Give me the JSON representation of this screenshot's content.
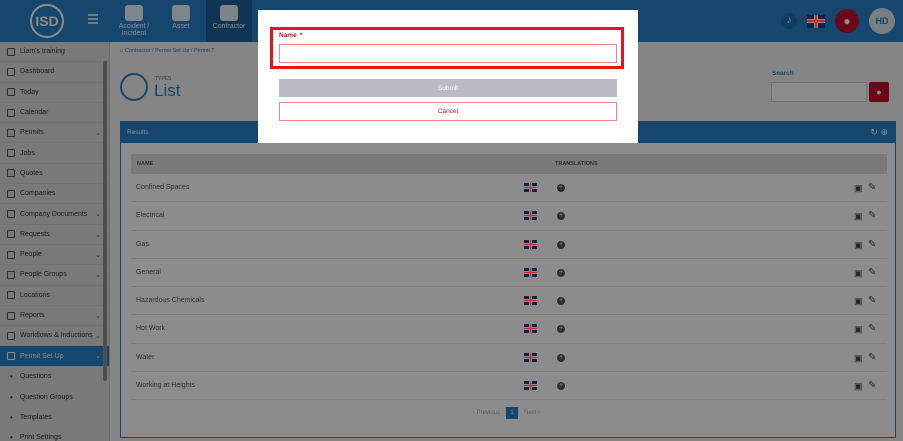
{
  "app": {
    "logo_text": "ISD",
    "nav_tabs": [
      {
        "label": "Accident / Incident"
      },
      {
        "label": "Asset"
      },
      {
        "label": "Contractor"
      }
    ],
    "user_initials": "HD"
  },
  "sidebar": {
    "items": [
      {
        "label": "Liam's training",
        "has_chevron": false
      },
      {
        "label": "Dashboard",
        "has_chevron": false
      },
      {
        "label": "Today",
        "has_chevron": false
      },
      {
        "label": "Calendar",
        "has_chevron": false
      },
      {
        "label": "Permits",
        "has_chevron": true
      },
      {
        "label": "Jobs",
        "has_chevron": false
      },
      {
        "label": "Quotes",
        "has_chevron": false
      },
      {
        "label": "Companies",
        "has_chevron": false
      },
      {
        "label": "Company Documents",
        "has_chevron": true
      },
      {
        "label": "Requests",
        "has_chevron": true
      },
      {
        "label": "People",
        "has_chevron": true
      },
      {
        "label": "People Groups",
        "has_chevron": true
      },
      {
        "label": "Locations",
        "has_chevron": false
      },
      {
        "label": "Reports",
        "has_chevron": true
      },
      {
        "label": "Workflows & Inductions",
        "has_chevron": true
      },
      {
        "label": "Permit Set Up",
        "has_chevron": true,
        "active": true
      }
    ],
    "subitems": [
      {
        "label": "Questions"
      },
      {
        "label": "Question Groups"
      },
      {
        "label": "Templates"
      },
      {
        "label": "Print Settings"
      }
    ]
  },
  "breadcrumb": {
    "items": [
      "Contractor",
      "Permit Set Up",
      "Permit T"
    ]
  },
  "page": {
    "kicker": "TYPES",
    "title": "List"
  },
  "search": {
    "label": "Search",
    "value": ""
  },
  "results": {
    "title": "Results",
    "columns": {
      "name": "NAME",
      "translations": "TRANSLATIONS"
    },
    "rows": [
      {
        "name": "Confined Spaces"
      },
      {
        "name": "Electrical"
      },
      {
        "name": "Gas"
      },
      {
        "name": "General"
      },
      {
        "name": "Hazardous Chemicals"
      },
      {
        "name": "Hot Work"
      },
      {
        "name": "Water"
      },
      {
        "name": "Working at Heights"
      }
    ],
    "pagination": {
      "previous": "Previous",
      "current": "1",
      "next": "Next"
    }
  },
  "modal": {
    "name_label": "Name",
    "required_mark": "*",
    "name_value": "",
    "submit_label": "Submit",
    "cancel_label": "Cancel"
  },
  "colors": {
    "brand_blue": "#2780c6",
    "danger_red": "#c8102e",
    "highlight_red": "#e8141c"
  }
}
